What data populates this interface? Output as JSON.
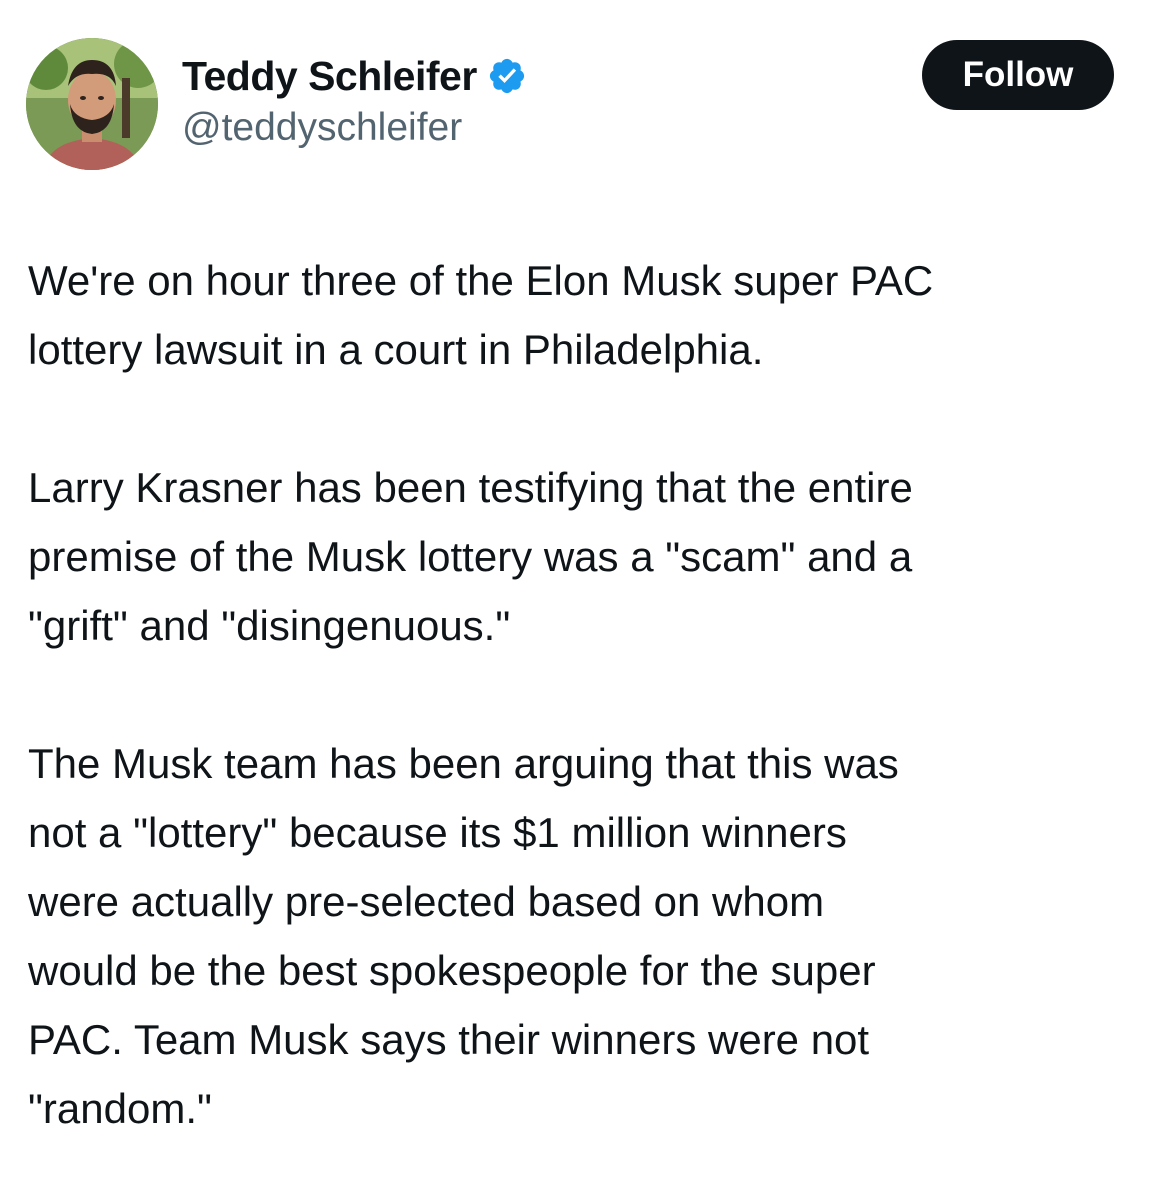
{
  "author": {
    "display_name": "Teddy Schleifer",
    "handle": "@teddyschleifer",
    "verified": true,
    "avatar_icon": "profile-photo"
  },
  "actions": {
    "follow_label": "Follow"
  },
  "tweet": {
    "paragraphs": [
      {
        "lines": [
          "We're on hour three of the Elon Musk super PAC",
          "lottery lawsuit in a court in Philadelphia."
        ]
      },
      {
        "lines": [
          "Larry Krasner has been testifying that the entire",
          "premise of the Musk lottery was a \"scam\" and a",
          "\"grift\" and \"disingenuous.\""
        ]
      },
      {
        "lines": [
          "The Musk team has been arguing that this was",
          "not a \"lottery\" because its $1 million winners",
          "were actually pre-selected based on whom",
          "would be the best spokespeople for the super",
          "PAC.  Team Musk says their winners were not",
          "\"random.\""
        ]
      }
    ]
  },
  "colors": {
    "text": "#0f1419",
    "secondary_text": "#536471",
    "verified_blue": "#1d9bf0",
    "follow_bg": "#0f1419",
    "follow_text": "#ffffff"
  }
}
